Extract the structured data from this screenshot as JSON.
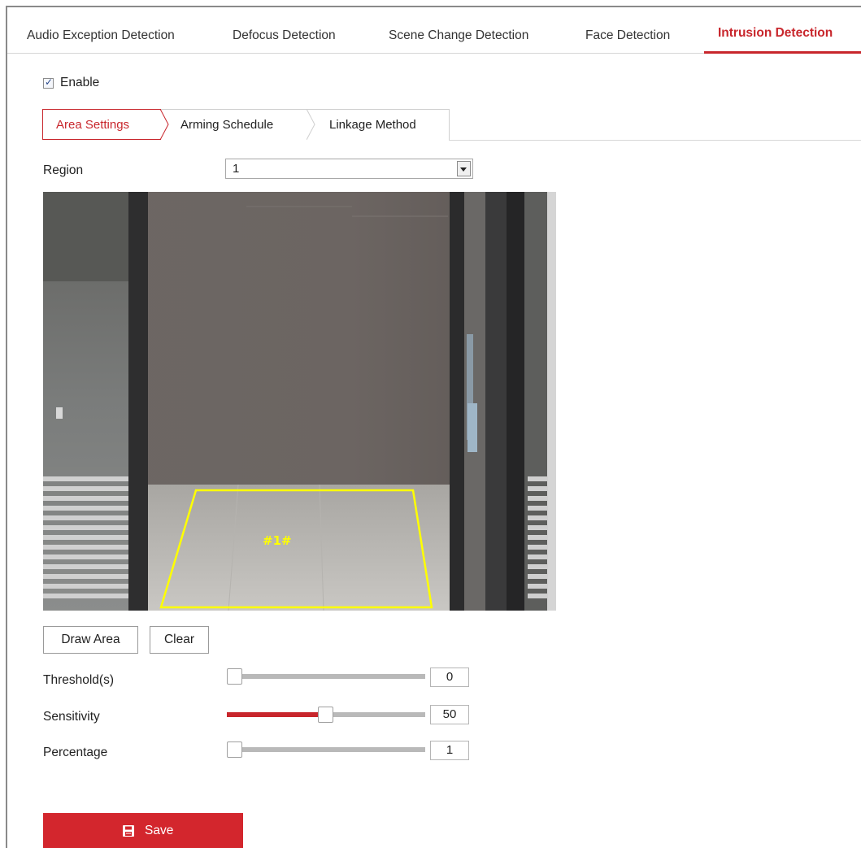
{
  "top_tabs": [
    {
      "label": "Audio Exception Detection"
    },
    {
      "label": "Defocus Detection"
    },
    {
      "label": "Scene Change Detection"
    },
    {
      "label": "Face Detection"
    },
    {
      "label": "Intrusion Detection",
      "active": true
    }
  ],
  "enable": {
    "label": "Enable",
    "checked": true
  },
  "sub_tabs": [
    {
      "label": "Area Settings",
      "active": true
    },
    {
      "label": "Arming Schedule"
    },
    {
      "label": "Linkage Method"
    }
  ],
  "region": {
    "label": "Region",
    "value": "1"
  },
  "video": {
    "roi_label": "#1#"
  },
  "buttons": {
    "draw_area": "Draw Area",
    "clear": "Clear"
  },
  "sliders": [
    {
      "label": "Threshold(s)",
      "value": "0",
      "fraction": 0.0
    },
    {
      "label": "Sensitivity",
      "value": "50",
      "fraction": 0.5
    },
    {
      "label": "Percentage",
      "value": "1",
      "fraction": 0.0
    }
  ],
  "save": {
    "label": "Save"
  },
  "colors": {
    "accent": "#c8262c",
    "save_bg": "#d3262d",
    "roi_outline": "#ffff00"
  }
}
